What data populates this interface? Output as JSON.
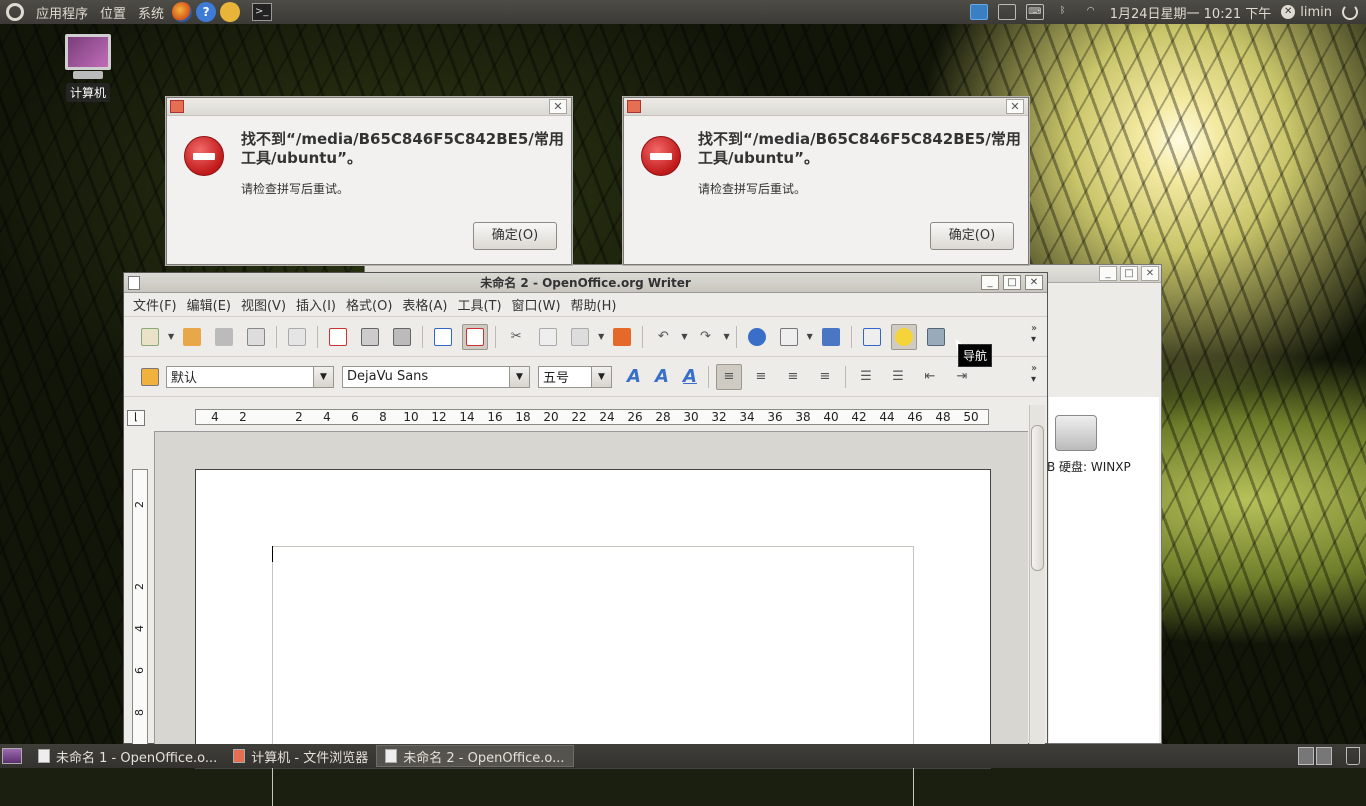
{
  "top_panel": {
    "menu_apps": "应用程序",
    "menu_places": "位置",
    "menu_system": "系统",
    "clock": "1月24日星期一 10:21 下午",
    "user": "limin"
  },
  "desktop": {
    "computer_label": "计算机"
  },
  "dialogs": [
    {
      "message": "找不到“/media/B65C846F5C842BE5/常用工具/ubuntu”。",
      "sub": "请检查拼写后重试。",
      "ok": "确定(O)"
    },
    {
      "message": "找不到“/media/B65C846F5C842BE5/常用工具/ubuntu”。",
      "sub": "请检查拼写后重试。",
      "ok": "确定(O)"
    }
  ],
  "filemanager": {
    "drive_label": "B 硬盘: WINXP"
  },
  "writer": {
    "title": "未命名 2 - OpenOffice.org Writer",
    "menus": [
      "文件(F)",
      "编辑(E)",
      "视图(V)",
      "插入(I)",
      "格式(O)",
      "表格(A)",
      "工具(T)",
      "窗口(W)",
      "帮助(H)"
    ],
    "style_value": "默认",
    "font_value": "DejaVu Sans",
    "size_value": "五号",
    "ruler_marks": [
      "4",
      "2",
      "2",
      "4",
      "6",
      "8",
      "10",
      "12",
      "14",
      "16",
      "18",
      "20",
      "22",
      "24",
      "26",
      "28",
      "30",
      "32",
      "34",
      "36",
      "38",
      "40",
      "42",
      "44",
      "46",
      "48",
      "50"
    ],
    "vruler_marks": [
      "2",
      "2",
      "4",
      "6",
      "8"
    ],
    "tooltip": "导航"
  },
  "taskbar": {
    "items": [
      "未命名 1 - OpenOffice.o...",
      "计算机 - 文件浏览器",
      "未命名 2 - OpenOffice.o..."
    ]
  }
}
